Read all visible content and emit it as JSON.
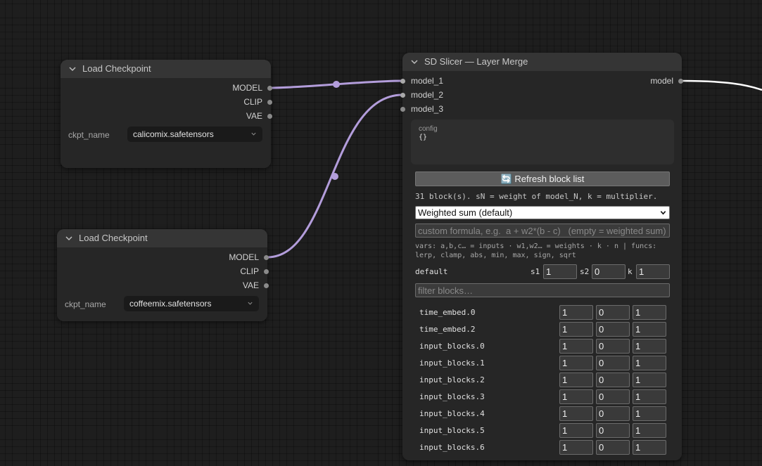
{
  "colors": {
    "canvas": "#1e1e1e",
    "node_body": "#262626",
    "node_title": "#353535",
    "model_wire": "#b39ddb",
    "output_wire": "#ffffff",
    "slot": "#8a8a8a"
  },
  "nodes": {
    "checkpoint_a": {
      "title": "Load Checkpoint",
      "outputs": [
        "MODEL",
        "CLIP",
        "VAE"
      ],
      "widget": {
        "label": "ckpt_name",
        "value": "calicomix.safetensors"
      }
    },
    "checkpoint_b": {
      "title": "Load Checkpoint",
      "outputs": [
        "MODEL",
        "CLIP",
        "VAE"
      ],
      "widget": {
        "label": "ckpt_name",
        "value": "coffeemix.safetensors"
      }
    },
    "slicer": {
      "title": "SD Slicer — Layer Merge",
      "inputs": [
        "model_1",
        "model_2",
        "model_3"
      ],
      "output": "model",
      "config": {
        "label": "config",
        "value": "{}"
      },
      "refresh_button": "🔄 Refresh block list",
      "info": "31 block(s). sN = weight of model_N, k = multiplier.",
      "mode_select": "Weighted sum (default)",
      "formula_placeholder": "custom formula, e.g.  a + w2*(b - c)   (empty = weighted sum)",
      "vars_help": "vars: a,b,c… = inputs · w1,w2… = weights · k · n | funcs:\nlerp, clamp, abs, min, max, sign, sqrt",
      "default_row": {
        "label": "default",
        "s1_label": "s1",
        "s1": "1",
        "s2_label": "s2",
        "s2": "0",
        "k_label": "k",
        "k": "1"
      },
      "filter_placeholder": "filter blocks…",
      "blocks": [
        {
          "name": "time_embed.0",
          "s1": "1",
          "s2": "0",
          "k": "1"
        },
        {
          "name": "time_embed.2",
          "s1": "1",
          "s2": "0",
          "k": "1"
        },
        {
          "name": "input_blocks.0",
          "s1": "1",
          "s2": "0",
          "k": "1"
        },
        {
          "name": "input_blocks.1",
          "s1": "1",
          "s2": "0",
          "k": "1"
        },
        {
          "name": "input_blocks.2",
          "s1": "1",
          "s2": "0",
          "k": "1"
        },
        {
          "name": "input_blocks.3",
          "s1": "1",
          "s2": "0",
          "k": "1"
        },
        {
          "name": "input_blocks.4",
          "s1": "1",
          "s2": "0",
          "k": "1"
        },
        {
          "name": "input_blocks.5",
          "s1": "1",
          "s2": "0",
          "k": "1"
        },
        {
          "name": "input_blocks.6",
          "s1": "1",
          "s2": "0",
          "k": "1"
        }
      ]
    }
  }
}
